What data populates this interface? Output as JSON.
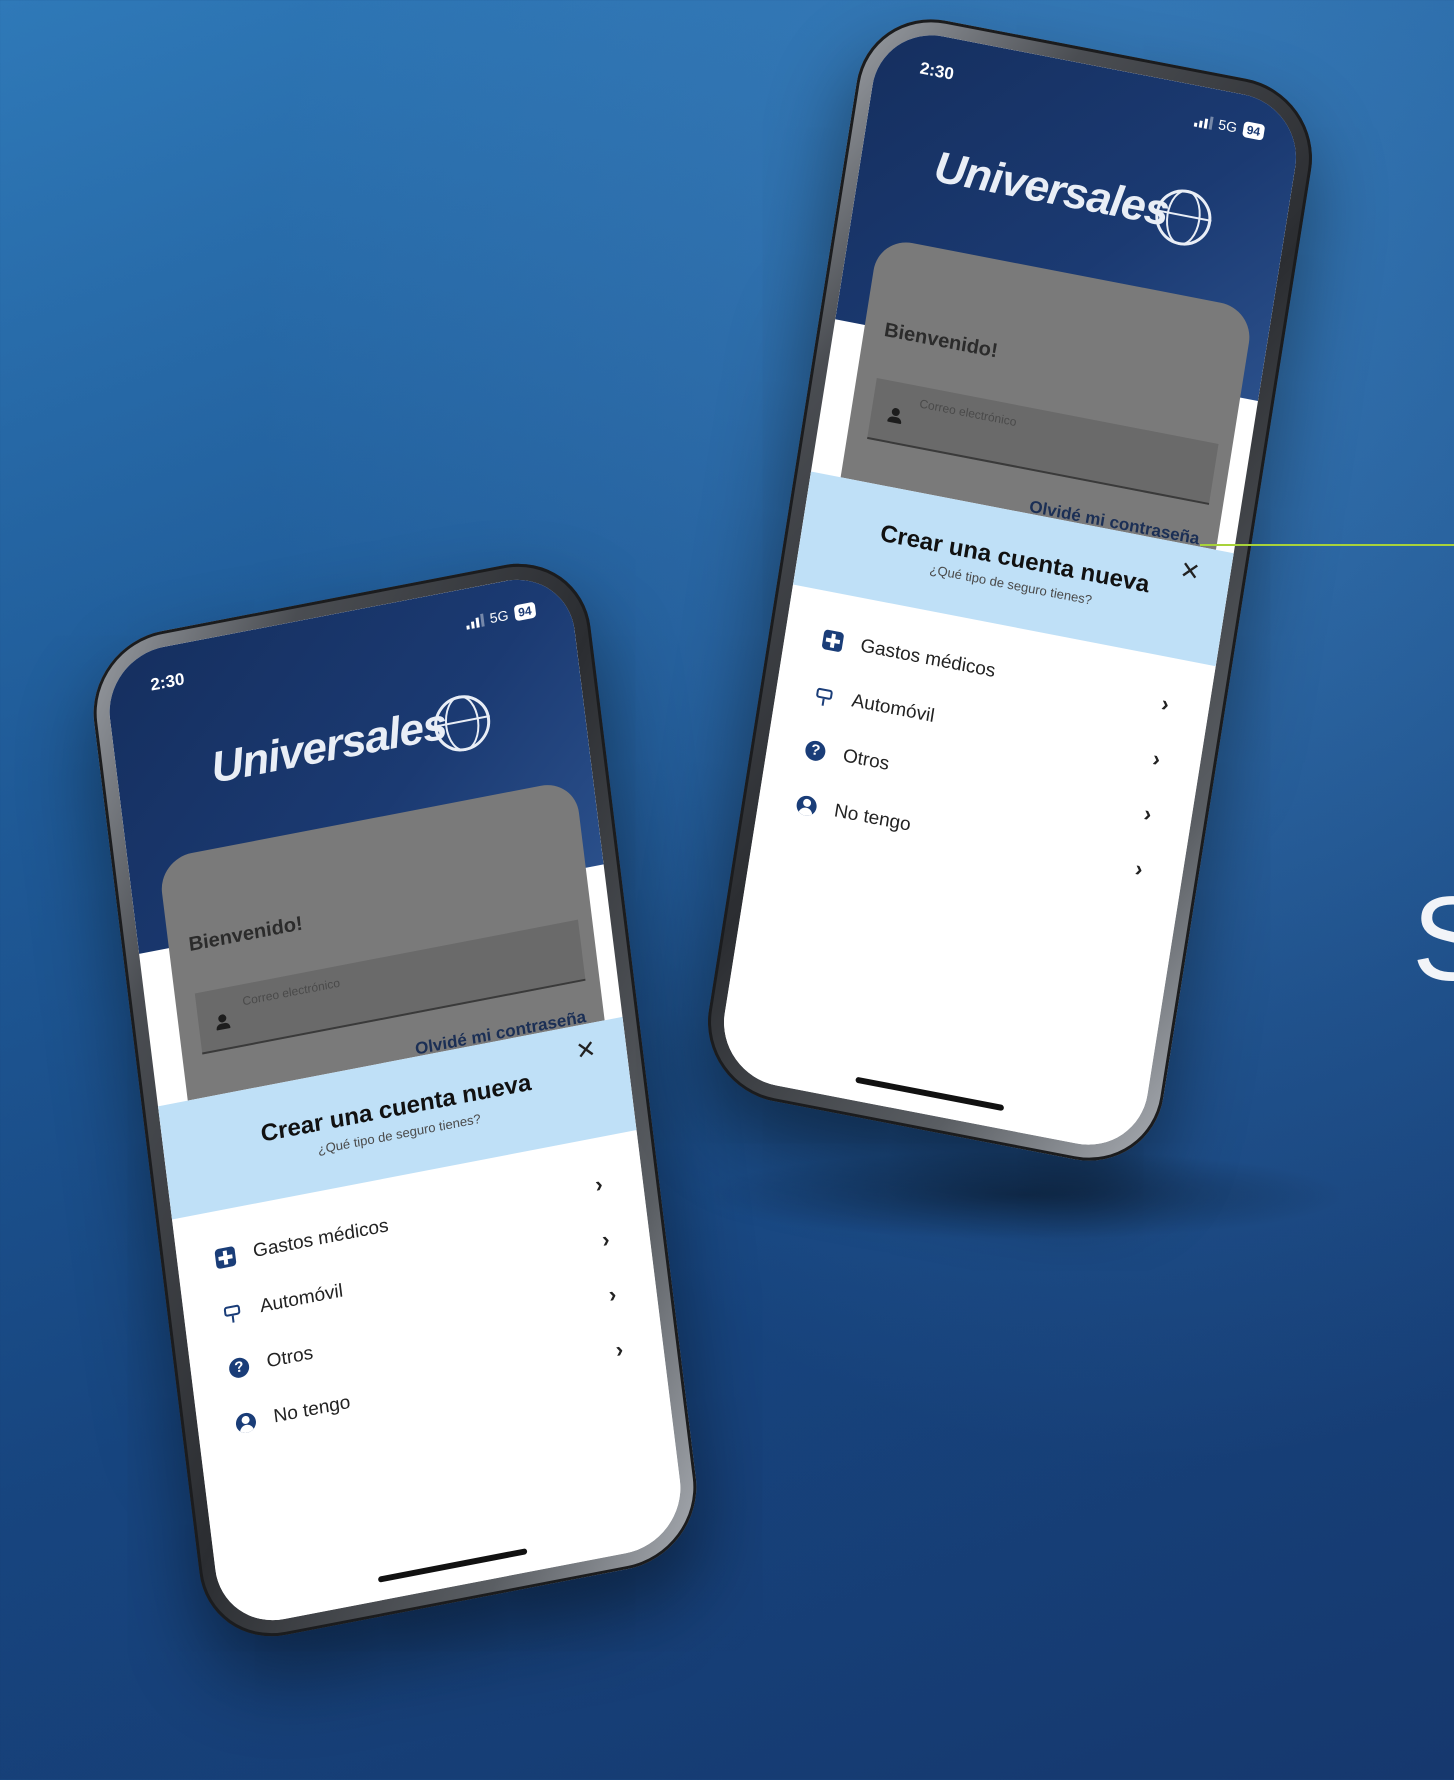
{
  "phones": [
    {
      "status": {
        "time": "2:30",
        "network": "5G",
        "battery": "94"
      },
      "logo_text": "Universales",
      "login": {
        "welcome": "Bienvenido!",
        "email_placeholder": "Correo electrónico",
        "forgot_password": "Olvidé mi contraseña"
      },
      "sheet": {
        "title": "Crear una cuenta nueva",
        "subtitle": "¿Qué tipo de seguro tienes?",
        "close_icon": "close-icon",
        "options": [
          {
            "label": "Gastos médicos",
            "icon": "medical-cross-icon"
          },
          {
            "label": "Automóvil",
            "icon": "car-icon"
          },
          {
            "label": "Otros",
            "icon": "question-icon"
          },
          {
            "label": "No tengo",
            "icon": "user-circle-icon"
          }
        ]
      }
    },
    {
      "status": {
        "time": "2:30",
        "network": "5G",
        "battery": "94"
      },
      "logo_text": "Universales",
      "login": {
        "welcome": "Bienvenido!",
        "email_placeholder": "Correo electrónico",
        "forgot_password": "Olvidé mi contraseña"
      },
      "sheet": {
        "title": "Crear una cuenta nueva",
        "subtitle": "¿Qué tipo de seguro tienes?",
        "close_icon": "close-icon",
        "options": [
          {
            "label": "Gastos médicos",
            "icon": "medical-cross-icon"
          },
          {
            "label": "Automóvil",
            "icon": "car-icon"
          },
          {
            "label": "Otros",
            "icon": "question-icon"
          },
          {
            "label": "No tengo",
            "icon": "user-circle-icon"
          }
        ]
      }
    }
  ],
  "side_text": "S",
  "colors": {
    "background": "#1f5a97",
    "sheet_header": "#bfe0f7",
    "brand_navy": "#1a3d78",
    "callout_line": "#a8d23a"
  }
}
